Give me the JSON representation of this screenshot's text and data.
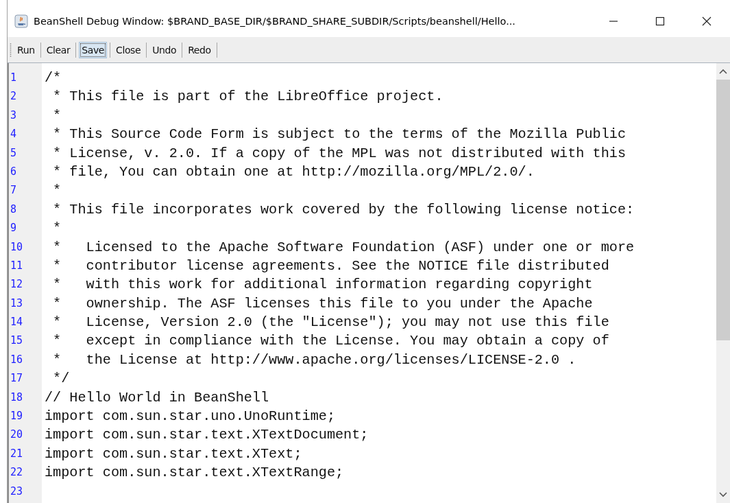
{
  "window": {
    "title": "BeanShell Debug Window: $BRAND_BASE_DIR/$BRAND_SHARE_SUBDIR/Scripts/beanshell/Hello..."
  },
  "toolbar": [
    {
      "label": "Run",
      "focused": false
    },
    {
      "label": "Clear",
      "focused": false
    },
    {
      "label": "Save",
      "focused": true
    },
    {
      "label": "Close",
      "focused": false
    },
    {
      "label": "Undo",
      "focused": false
    },
    {
      "label": "Redo",
      "focused": false
    }
  ],
  "editor": {
    "lines": [
      {
        "number": "1",
        "text": "/*"
      },
      {
        "number": "2",
        "text": " * This file is part of the LibreOffice project."
      },
      {
        "number": "3",
        "text": " *"
      },
      {
        "number": "4",
        "text": " * This Source Code Form is subject to the terms of the Mozilla Public"
      },
      {
        "number": "5",
        "text": " * License, v. 2.0. If a copy of the MPL was not distributed with this"
      },
      {
        "number": "6",
        "text": " * file, You can obtain one at http://mozilla.org/MPL/2.0/."
      },
      {
        "number": "7",
        "text": " *"
      },
      {
        "number": "8",
        "text": " * This file incorporates work covered by the following license notice:"
      },
      {
        "number": "9",
        "text": " *"
      },
      {
        "number": "10",
        "text": " *   Licensed to the Apache Software Foundation (ASF) under one or more"
      },
      {
        "number": "11",
        "text": " *   contributor license agreements. See the NOTICE file distributed"
      },
      {
        "number": "12",
        "text": " *   with this work for additional information regarding copyright"
      },
      {
        "number": "13",
        "text": " *   ownership. The ASF licenses this file to you under the Apache"
      },
      {
        "number": "14",
        "text": " *   License, Version 2.0 (the \"License\"); you may not use this file"
      },
      {
        "number": "15",
        "text": " *   except in compliance with the License. You may obtain a copy of"
      },
      {
        "number": "16",
        "text": " *   the License at http://www.apache.org/licenses/LICENSE-2.0 ."
      },
      {
        "number": "17",
        "text": " */"
      },
      {
        "number": "18",
        "text": "// Hello World in BeanShell"
      },
      {
        "number": "19",
        "text": "import com.sun.star.uno.UnoRuntime;"
      },
      {
        "number": "20",
        "text": "import com.sun.star.text.XTextDocument;"
      },
      {
        "number": "21",
        "text": "import com.sun.star.text.XText;"
      },
      {
        "number": "22",
        "text": "import com.sun.star.text.XTextRange;"
      },
      {
        "number": "23"
      }
    ]
  }
}
